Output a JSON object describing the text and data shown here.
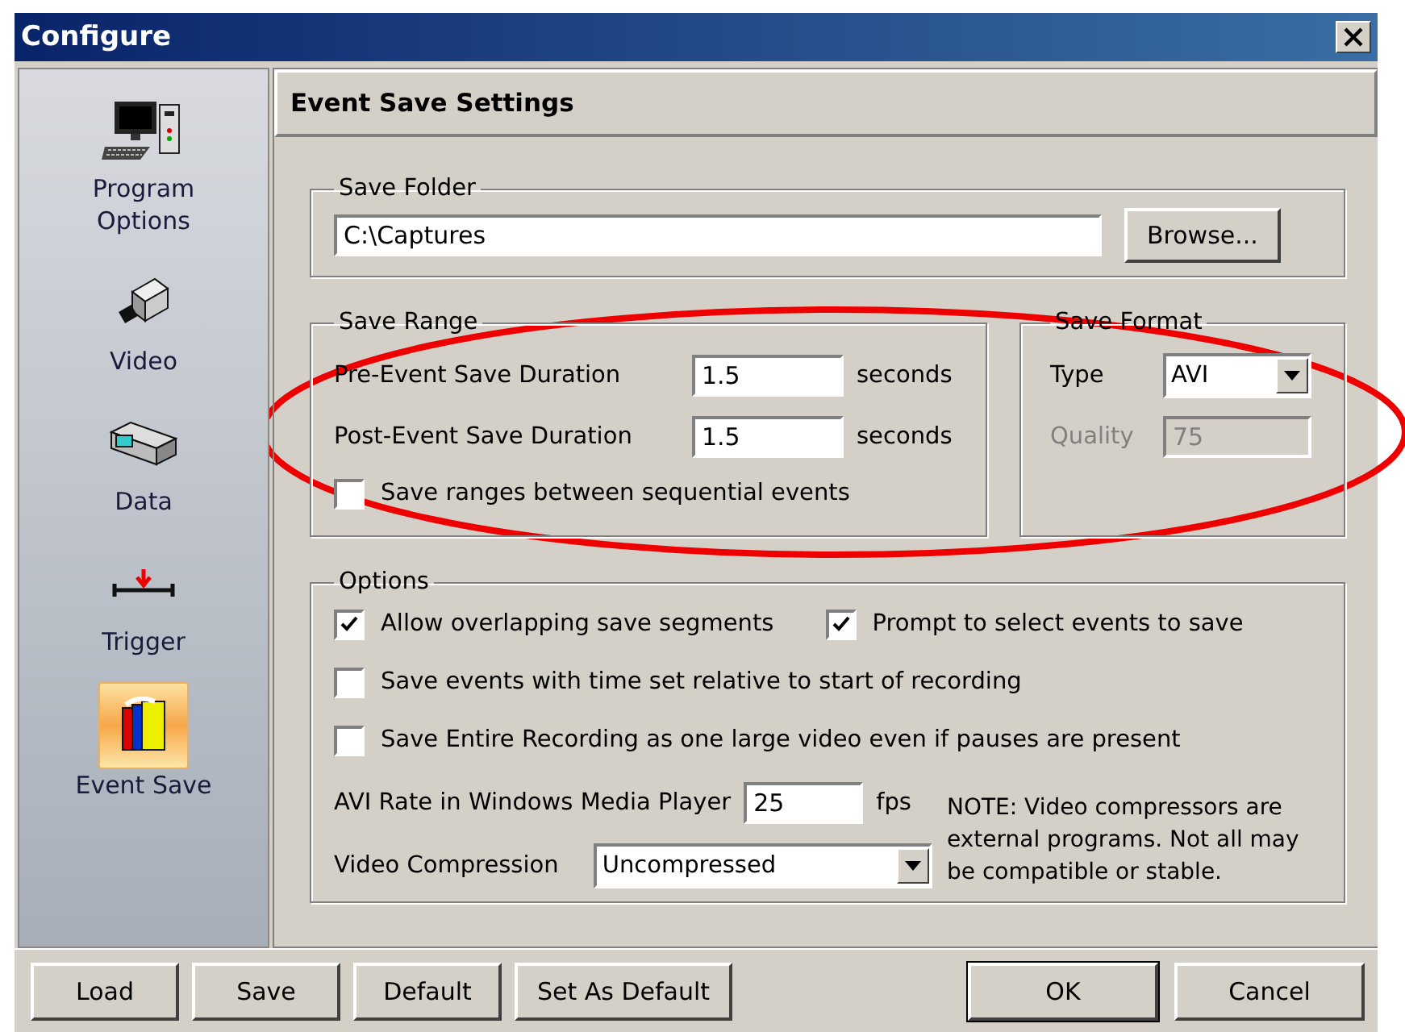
{
  "window": {
    "title": "Configure"
  },
  "sidebar": {
    "items": [
      {
        "label": "Program Options",
        "selected": false
      },
      {
        "label": "Video",
        "selected": false
      },
      {
        "label": "Data",
        "selected": false
      },
      {
        "label": "Trigger",
        "selected": false
      },
      {
        "label": "Event Save",
        "selected": true
      }
    ]
  },
  "header": "Event Save Settings",
  "save_folder": {
    "legend": "Save Folder",
    "value": "C:\\Captures",
    "button": "Browse..."
  },
  "save_range": {
    "legend": "Save Range",
    "rows": [
      {
        "label": "Pre-Event Save Duration",
        "value": "1.5",
        "unit": "seconds"
      },
      {
        "label": "Post-Event Save Duration",
        "value": "1.5",
        "unit": "seconds"
      }
    ],
    "checkbox": {
      "label": "Save ranges between sequential events",
      "checked": false
    }
  },
  "save_format": {
    "legend": "Save Format",
    "type_label": "Type",
    "type_value": "AVI",
    "quality_label": "Quality",
    "quality_value": "75",
    "quality_disabled": true
  },
  "options": {
    "legend": "Options",
    "checkboxes": [
      {
        "label": "Allow overlapping save segments",
        "checked": true
      },
      {
        "label": "Prompt to select events to save",
        "checked": true
      },
      {
        "label": "Save events with time set relative to start of recording",
        "checked": false
      },
      {
        "label": "Save Entire Recording as one large video even if pauses are present",
        "checked": false
      }
    ],
    "avi_rate": {
      "label": "AVI Rate in Windows Media Player",
      "value": "25",
      "unit": "fps"
    },
    "compression": {
      "label": "Video Compression",
      "value": "Uncompressed"
    },
    "note": "NOTE: Video compressors are external programs.  Not all may be compatible or stable."
  },
  "buttons_left": [
    {
      "label": "Load",
      "default": false
    },
    {
      "label": "Save",
      "default": false
    },
    {
      "label": "Default",
      "default": false
    },
    {
      "label": "Set As Default",
      "default": false
    }
  ],
  "buttons_right": [
    {
      "label": "OK",
      "default": true
    },
    {
      "label": "Cancel",
      "default": false
    }
  ]
}
